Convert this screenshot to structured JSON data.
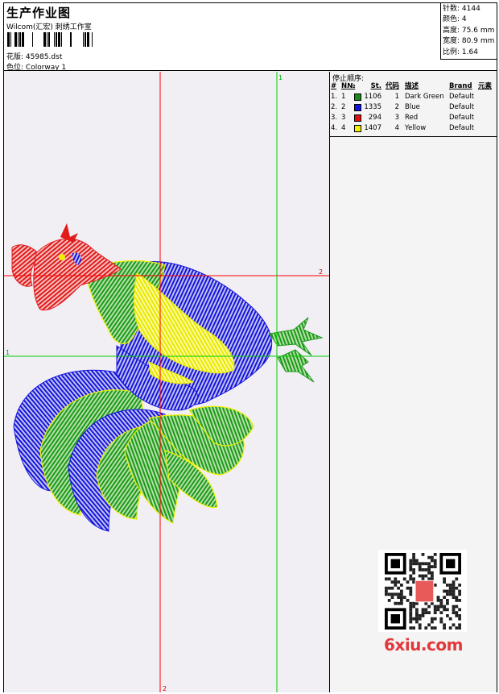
{
  "header": {
    "title": "生产作业图",
    "company": "Wilcom(汇宏) 刺绣工作室",
    "design_label": "花版:",
    "design_value": "45985.dst",
    "color_label": "色位:",
    "color_value": "Colorway 1"
  },
  "stats": [
    {
      "label": "针数:",
      "value": "4144"
    },
    {
      "label": "颜色:",
      "value": "4"
    },
    {
      "label": "高度:",
      "value": "75.6 mm"
    },
    {
      "label": "宽度:",
      "value": "80.9 mm"
    },
    {
      "label": "比例:",
      "value": "1.64"
    }
  ],
  "panel": {
    "stop_sequence_label": "停止顺序:",
    "columns": {
      "num": "#",
      "no": "N№",
      "st": "St.",
      "code": "代码",
      "desc": "描述",
      "brand": "Brand",
      "element": "元素"
    },
    "rows": [
      {
        "num": "1.",
        "no": "1",
        "color": "#1a8a1a",
        "st": "1106",
        "code": "1",
        "desc": "Dark Green",
        "brand": "Default"
      },
      {
        "num": "2.",
        "no": "2",
        "color": "#1010e0",
        "st": "1335",
        "code": "2",
        "desc": "Blue",
        "brand": "Default"
      },
      {
        "num": "3.",
        "no": "3",
        "color": "#e01010",
        "st": "294",
        "code": "3",
        "desc": "Red",
        "brand": "Default"
      },
      {
        "num": "4.",
        "no": "4",
        "color": "#f2f200",
        "st": "1407",
        "code": "4",
        "desc": "Yellow",
        "brand": "Default"
      }
    ]
  },
  "guides": {
    "horizontal_1": "1",
    "horizontal_2": "2",
    "vertical_1": "1",
    "vertical_2": "2"
  },
  "colors": {
    "green": "#1a9a1a",
    "blue": "#1515dd",
    "red": "#e21a1a",
    "yellow": "#f0f000",
    "guide_red": "#ff0000",
    "guide_green": "#00cc00"
  },
  "watermark": "6xiu.com"
}
